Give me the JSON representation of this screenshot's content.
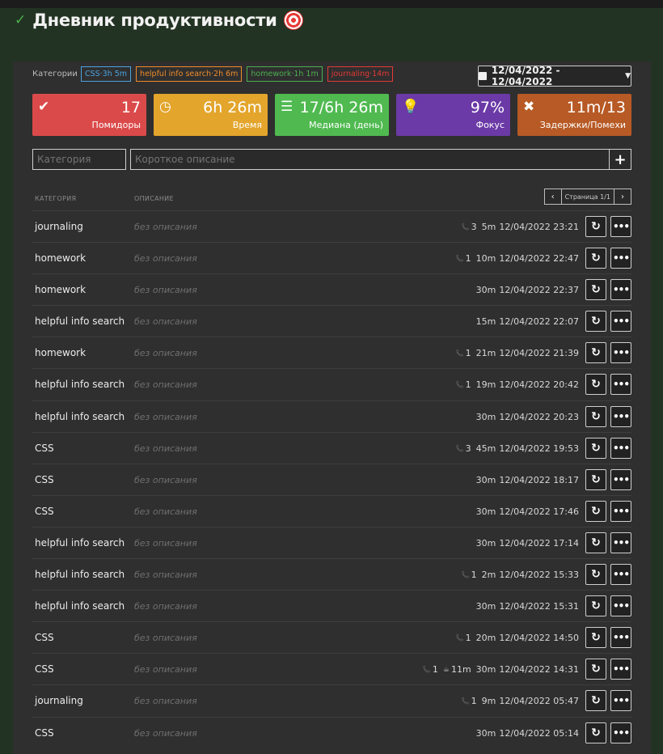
{
  "app": {
    "title": "Дневник продуктивности"
  },
  "filters": {
    "categories_label": "Категории",
    "tags": [
      {
        "text": "CSS·3h 5m",
        "color": "#4aa3df"
      },
      {
        "text": "helpful info search·2h 6m",
        "color": "#f08c2a"
      },
      {
        "text": "homework·1h 1m",
        "color": "#4caf50"
      },
      {
        "text": "journaling·14m",
        "color": "#e53935"
      }
    ],
    "date_range": "12/04/2022 - 12/04/2022"
  },
  "stats": [
    {
      "icon": "check-circle-icon",
      "glyph": "✔",
      "value": "17",
      "label": "Помидоры",
      "color": "#db4a4a"
    },
    {
      "icon": "clock-icon",
      "glyph": "◷",
      "value": "6h 26m",
      "label": "Время",
      "color": "#e3a52c"
    },
    {
      "icon": "list-icon",
      "glyph": "☰",
      "value": "17/6h 26m",
      "label": "Медиана (день)",
      "color": "#50ba50"
    },
    {
      "icon": "lightbulb-icon",
      "glyph": "💡",
      "value": "97%",
      "label": "Фокус",
      "color": "#6b3aa6"
    },
    {
      "icon": "times-icon",
      "glyph": "✖",
      "value": "11m/13",
      "label": "Задержки/Помехи",
      "color": "#b75a25"
    }
  ],
  "form": {
    "category_placeholder": "Категория",
    "description_placeholder": "Короткое описание",
    "add_label": "+"
  },
  "table": {
    "col_category": "Категория",
    "col_description": "Описание",
    "pager_text": "Страница 1/1",
    "rows": [
      {
        "category": "journaling",
        "description": "без описания",
        "calls": "3",
        "cup": "",
        "duration": "5m",
        "datetime": "12/04/2022 23:21"
      },
      {
        "category": "homework",
        "description": "без описания",
        "calls": "1",
        "cup": "",
        "duration": "10m",
        "datetime": "12/04/2022 22:47"
      },
      {
        "category": "homework",
        "description": "без описания",
        "calls": "",
        "cup": "",
        "duration": "30m",
        "datetime": "12/04/2022 22:37"
      },
      {
        "category": "helpful info search",
        "description": "без описания",
        "calls": "",
        "cup": "",
        "duration": "15m",
        "datetime": "12/04/2022 22:07"
      },
      {
        "category": "homework",
        "description": "без описания",
        "calls": "1",
        "cup": "",
        "duration": "21m",
        "datetime": "12/04/2022 21:39"
      },
      {
        "category": "helpful info search",
        "description": "без описания",
        "calls": "1",
        "cup": "",
        "duration": "19m",
        "datetime": "12/04/2022 20:42"
      },
      {
        "category": "helpful info search",
        "description": "без описания",
        "calls": "",
        "cup": "",
        "duration": "30m",
        "datetime": "12/04/2022 20:23"
      },
      {
        "category": "CSS",
        "description": "без описания",
        "calls": "3",
        "cup": "",
        "duration": "45m",
        "datetime": "12/04/2022 19:53"
      },
      {
        "category": "CSS",
        "description": "без описания",
        "calls": "",
        "cup": "",
        "duration": "30m",
        "datetime": "12/04/2022 18:17"
      },
      {
        "category": "CSS",
        "description": "без описания",
        "calls": "",
        "cup": "",
        "duration": "30m",
        "datetime": "12/04/2022 17:46"
      },
      {
        "category": "helpful info search",
        "description": "без описания",
        "calls": "",
        "cup": "",
        "duration": "30m",
        "datetime": "12/04/2022 17:14"
      },
      {
        "category": "helpful info search",
        "description": "без описания",
        "calls": "1",
        "cup": "",
        "duration": "2m",
        "datetime": "12/04/2022 15:33"
      },
      {
        "category": "helpful info search",
        "description": "без описания",
        "calls": "",
        "cup": "",
        "duration": "30m",
        "datetime": "12/04/2022 15:31"
      },
      {
        "category": "CSS",
        "description": "без описания",
        "calls": "1",
        "cup": "",
        "duration": "20m",
        "datetime": "12/04/2022 14:50"
      },
      {
        "category": "CSS",
        "description": "без описания",
        "calls": "1",
        "cup": "11m",
        "duration": "30m",
        "datetime": "12/04/2022 14:31"
      },
      {
        "category": "journaling",
        "description": "без описания",
        "calls": "1",
        "cup": "",
        "duration": "9m",
        "datetime": "12/04/2022 05:47"
      },
      {
        "category": "CSS",
        "description": "без описания",
        "calls": "",
        "cup": "",
        "duration": "30m",
        "datetime": "12/04/2022 05:14"
      }
    ]
  }
}
